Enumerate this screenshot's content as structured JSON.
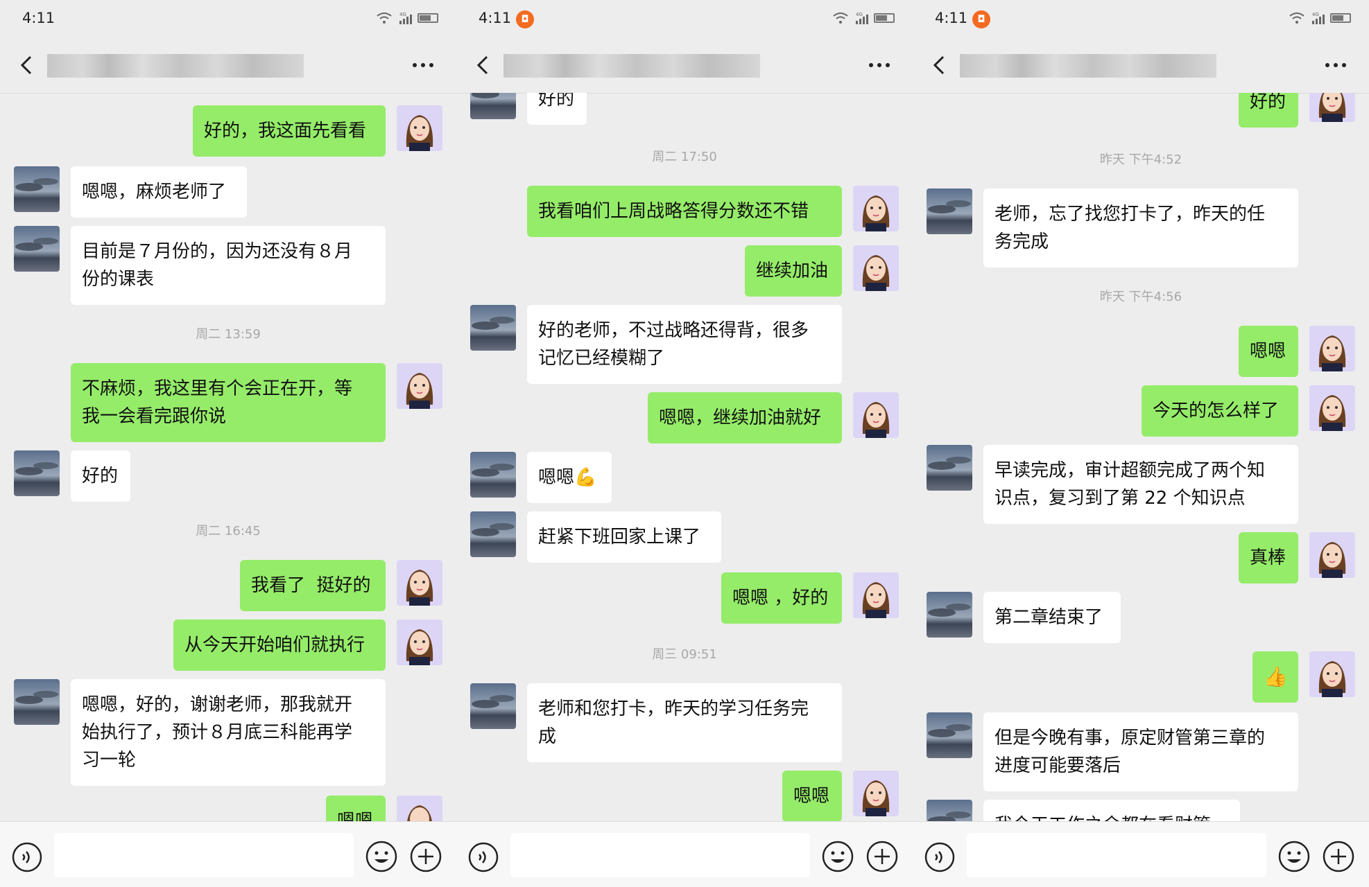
{
  "status": {
    "time": "4:11",
    "network": "4G",
    "notify_glyph": "◘",
    "notify_color": "#f36b21"
  },
  "colors": {
    "outgoing_bubble": "#95ec69",
    "incoming_bubble": "#ffffff",
    "background": "#ededed"
  },
  "icons": {
    "back": "chevron-left-icon",
    "more": "more-dots-icon",
    "voice": "voice-icon",
    "emoji": "emoji-icon",
    "plus": "plus-icon"
  },
  "screen1": {
    "messages": [
      {
        "side": "out",
        "text": "好的，我这面先看看"
      },
      {
        "side": "in",
        "text": "嗯嗯，麻烦老师了"
      },
      {
        "side": "in",
        "text": "目前是７月份的，因为还没有８月\n份的课表"
      },
      {
        "side": "time",
        "text": "周二 13:59"
      },
      {
        "side": "out",
        "text": "不麻烦，我这里有个会正在开，等\n我一会看完跟你说"
      },
      {
        "side": "in",
        "text": "好的"
      },
      {
        "side": "time",
        "text": "周二 16:45"
      },
      {
        "side": "out",
        "text": "我看了  挺好的"
      },
      {
        "side": "out",
        "text": "从今天开始咱们就执行"
      },
      {
        "side": "in",
        "text": "嗯嗯，好的，谢谢老师，那我就开\n始执行了，预计８月底三科能再学\n习一轮"
      },
      {
        "side": "out",
        "text": "嗯嗯"
      }
    ]
  },
  "screen2": {
    "messages": [
      {
        "side": "in",
        "text": "好的"
      },
      {
        "side": "time",
        "text": "周二 17:50"
      },
      {
        "side": "out",
        "text": "我看咱们上周战略答得分数还不错"
      },
      {
        "side": "out",
        "text": "继续加油"
      },
      {
        "side": "in",
        "text": "好的老师，不过战略还得背，很多\n记忆已经模糊了"
      },
      {
        "side": "out",
        "text": "嗯嗯，继续加油就好"
      },
      {
        "side": "in",
        "text": "嗯嗯💪"
      },
      {
        "side": "in",
        "text": "赶紧下班回家上课了"
      },
      {
        "side": "out",
        "text": "嗯嗯 ，好的"
      },
      {
        "side": "time",
        "text": "周三 09:51"
      },
      {
        "side": "in",
        "text": "老师和您打卡，昨天的学习任务完\n成"
      },
      {
        "side": "out",
        "text": "嗯嗯"
      }
    ]
  },
  "screen3": {
    "messages": [
      {
        "side": "out",
        "text": "好的"
      },
      {
        "side": "time",
        "text": "昨天 下午4:52"
      },
      {
        "side": "in",
        "text": "老师，忘了找您打卡了，昨天的任\n务完成"
      },
      {
        "side": "time",
        "text": "昨天 下午4:56"
      },
      {
        "side": "out",
        "text": "嗯嗯"
      },
      {
        "side": "out",
        "text": "今天的怎么样了"
      },
      {
        "side": "in",
        "text": "早读完成，审计超额完成了两个知\n识点，复习到了第 22 个知识点"
      },
      {
        "side": "out",
        "text": "真棒"
      },
      {
        "side": "in",
        "text": "第二章结束了"
      },
      {
        "side": "out",
        "text": "👍"
      },
      {
        "side": "in",
        "text": "但是今晚有事，原定财管第三章的\n进度可能要落后"
      },
      {
        "side": "in",
        "text": "我今天工作之余都在看财管"
      }
    ]
  }
}
